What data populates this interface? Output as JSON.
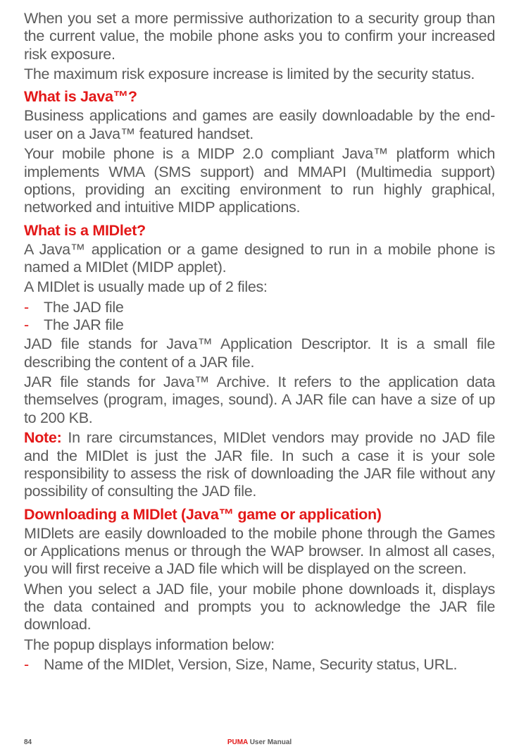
{
  "intro": {
    "p1": "When you set a more permissive authorization to a security group than the current value, the mobile phone asks you to confirm your increased risk exposure.",
    "p2": "The maximum risk exposure increase is limited by the security status."
  },
  "section1": {
    "heading": "What is Java™?",
    "p1": "Business applications and games are easily downloadable by the end-user on a Java™ featured handset.",
    "p2": "Your mobile phone is a MIDP 2.0 compliant Java™ platform which implements WMA (SMS support) and MMAPI (Multimedia support) options, providing an exciting environment to run highly graphical, networked and intuitive MIDP applications."
  },
  "section2": {
    "heading": "What is a MIDlet?",
    "p1": "A Java™ application or a game designed to run in a mobile phone is named a MIDlet (MIDP applet).",
    "p2": "A MIDlet is usually made up of 2 files:",
    "list": {
      "item1": "The JAD file",
      "item2": "The JAR file"
    },
    "p3": "JAD file stands for Java™ Application Descriptor. It is a small file describing the content of a JAR file.",
    "p4": "JAR file stands for Java™ Archive. It refers to the application data themselves (program, images, sound). A JAR file can have a size of up to 200 KB.",
    "note_label": "Note:",
    "note_text": " In rare circumstances, MIDlet vendors may provide no JAD file and the MIDlet is just the JAR file. In such a case it is your sole responsibility to assess the risk of downloading the JAR file without any possibility of consulting the JAD file."
  },
  "section3": {
    "heading": "Downloading a MIDlet (Java™ game or application)",
    "p1": "MIDlets are easily downloaded to the mobile phone through the Games or Applications menus or through the WAP browser. In almost all cases, you will first receive a JAD file which will be displayed on the screen.",
    "p2": "When you select a JAD file, your mobile phone downloads it, displays the data contained and prompts you to acknowledge the JAR file download.",
    "p3": "The popup displays information below:",
    "list": {
      "item1": "Name of the MIDlet, Version, Size, Name, Security status, URL."
    }
  },
  "footer": {
    "page_number": "84",
    "brand": "PUMA",
    "title_suffix": " User Manual"
  }
}
